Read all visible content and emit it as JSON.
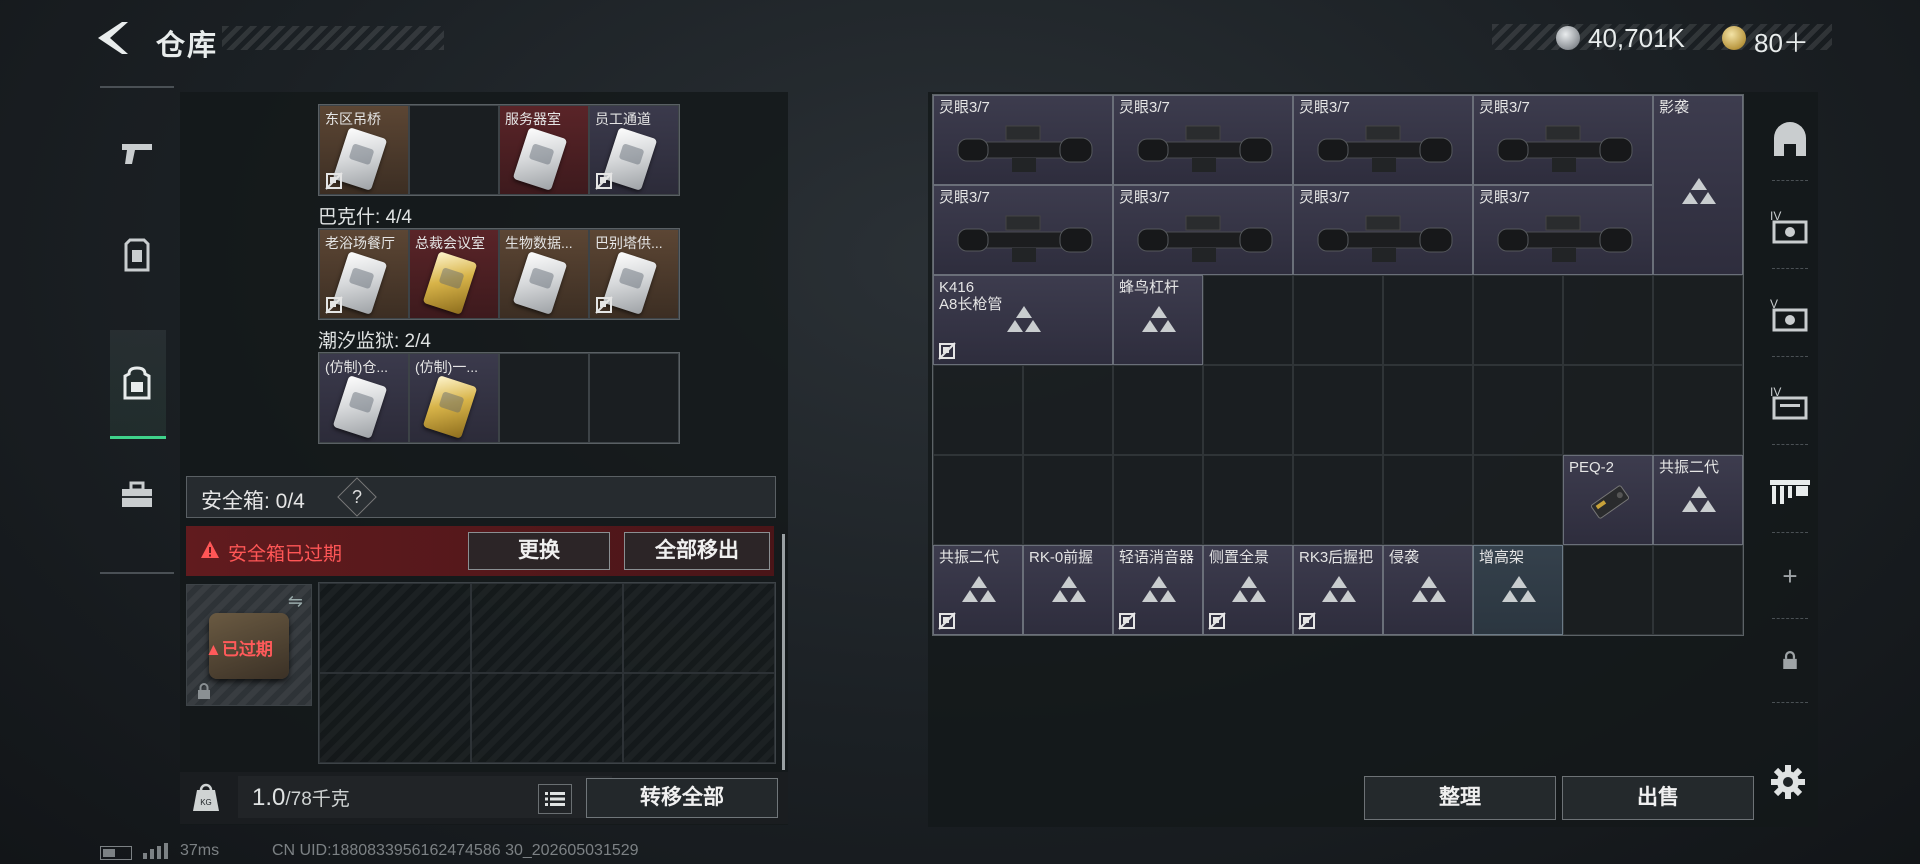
{
  "header": {
    "title": "仓库",
    "currency_silver": "40,701K",
    "currency_gold": "80＋"
  },
  "left_nav": {
    "items": [
      "weapons",
      "armor",
      "backpack",
      "toolbox"
    ],
    "active": "backpack"
  },
  "key_groups": [
    {
      "label": "",
      "rows": 1,
      "items": [
        {
          "name": "东区吊桥",
          "color": "brown",
          "card": "silver",
          "flag": true
        },
        {
          "name": "",
          "color": "empty"
        },
        {
          "name": "服务器室",
          "color": "red",
          "card": "silver",
          "flag": false
        },
        {
          "name": "员工通道",
          "color": "purple",
          "card": "silver",
          "flag": true
        }
      ]
    },
    {
      "label": "巴克什: 4/4",
      "rows": 1,
      "items": [
        {
          "name": "老浴场餐厅",
          "color": "brown",
          "card": "silver",
          "flag": true
        },
        {
          "name": "总裁会议室",
          "color": "red",
          "card": "gold",
          "flag": false
        },
        {
          "name": "生物数据...",
          "color": "brown",
          "card": "silver",
          "flag": false
        },
        {
          "name": "巴别塔供...",
          "color": "brown",
          "card": "silver",
          "flag": true
        }
      ]
    },
    {
      "label": "潮汐监狱: 2/4",
      "rows": 1,
      "items": [
        {
          "name": "(仿制)仓...",
          "color": "purple",
          "card": "silver",
          "flag": false
        },
        {
          "name": "(仿制)一...",
          "color": "purple",
          "card": "gold",
          "flag": false
        },
        {
          "name": "",
          "color": "empty"
        },
        {
          "name": "",
          "color": "empty"
        }
      ]
    }
  ],
  "safe_box": {
    "label": "安全箱: 0/4",
    "help": "?",
    "expired_notice": "安全箱已过期",
    "replace_label": "更换",
    "move_all_label": "全部移出",
    "case_badge": "已过期"
  },
  "bottom_bar": {
    "weight": "1.0",
    "weight_max": "/78千克",
    "kg_icon_text": "KG",
    "transfer_all_label": "转移全部"
  },
  "status": {
    "ping": "37ms",
    "uid": "CN UID:1880833956162474586 30_202605031529"
  },
  "stash": {
    "cols": 9,
    "rows": 6,
    "items": [
      {
        "name": "灵眼3/7",
        "col": 1,
        "row": 1,
        "w": 2,
        "h": 1,
        "kind": "scope",
        "flag": false
      },
      {
        "name": "灵眼3/7",
        "col": 3,
        "row": 1,
        "w": 2,
        "h": 1,
        "kind": "scope",
        "flag": false
      },
      {
        "name": "灵眼3/7",
        "col": 5,
        "row": 1,
        "w": 2,
        "h": 1,
        "kind": "scope",
        "flag": false
      },
      {
        "name": "灵眼3/7",
        "col": 7,
        "row": 1,
        "w": 2,
        "h": 1,
        "kind": "scope",
        "flag": false
      },
      {
        "name": "影袭",
        "col": 9,
        "row": 1,
        "w": 1,
        "h": 2,
        "kind": "tri",
        "flag": false
      },
      {
        "name": "灵眼3/7",
        "col": 1,
        "row": 2,
        "w": 2,
        "h": 1,
        "kind": "scope",
        "flag": false
      },
      {
        "name": "灵眼3/7",
        "col": 3,
        "row": 2,
        "w": 2,
        "h": 1,
        "kind": "scope",
        "flag": false
      },
      {
        "name": "灵眼3/7",
        "col": 5,
        "row": 2,
        "w": 2,
        "h": 1,
        "kind": "scope",
        "flag": false
      },
      {
        "name": "灵眼3/7",
        "col": 7,
        "row": 2,
        "w": 2,
        "h": 1,
        "kind": "scope",
        "flag": false
      },
      {
        "name": "K416\nA8长枪管",
        "col": 1,
        "row": 3,
        "w": 2,
        "h": 1,
        "kind": "tri",
        "flag": true
      },
      {
        "name": "蜂鸟杠杆",
        "col": 3,
        "row": 3,
        "w": 1,
        "h": 1,
        "kind": "tri",
        "flag": false
      },
      {
        "name": "PEQ-2",
        "col": 8,
        "row": 5,
        "w": 1,
        "h": 1,
        "kind": "peq",
        "flag": false
      },
      {
        "name": "共振二代",
        "col": 9,
        "row": 5,
        "w": 1,
        "h": 1,
        "kind": "tri",
        "flag": false
      },
      {
        "name": "共振二代",
        "col": 1,
        "row": 6,
        "w": 1,
        "h": 1,
        "kind": "tri",
        "flag": true
      },
      {
        "name": "RK-0前握",
        "col": 2,
        "row": 6,
        "w": 1,
        "h": 1,
        "kind": "tri",
        "flag": false
      },
      {
        "name": "轻语消音器",
        "col": 3,
        "row": 6,
        "w": 1,
        "h": 1,
        "kind": "tri",
        "flag": true
      },
      {
        "name": "侧置全景",
        "col": 4,
        "row": 6,
        "w": 1,
        "h": 1,
        "kind": "tri",
        "flag": true
      },
      {
        "name": "RK3后握把",
        "col": 5,
        "row": 6,
        "w": 1,
        "h": 1,
        "kind": "tri",
        "flag": true
      },
      {
        "name": "侵袭",
        "col": 6,
        "row": 6,
        "w": 1,
        "h": 1,
        "kind": "tri",
        "flag": false
      },
      {
        "name": "增高架",
        "col": 7,
        "row": 6,
        "w": 1,
        "h": 1,
        "kind": "tri",
        "flag": false,
        "blue": true
      }
    ]
  },
  "right_nav": {
    "items": [
      "helmet",
      "case-iv",
      "case-v",
      "case-iv-2",
      "rack",
      "add",
      "lock"
    ]
  },
  "actions": {
    "sort_label": "整理",
    "sell_label": "出售"
  },
  "colors": {
    "accent_green": "#3fd38b",
    "expired_red": "#ff5656"
  }
}
